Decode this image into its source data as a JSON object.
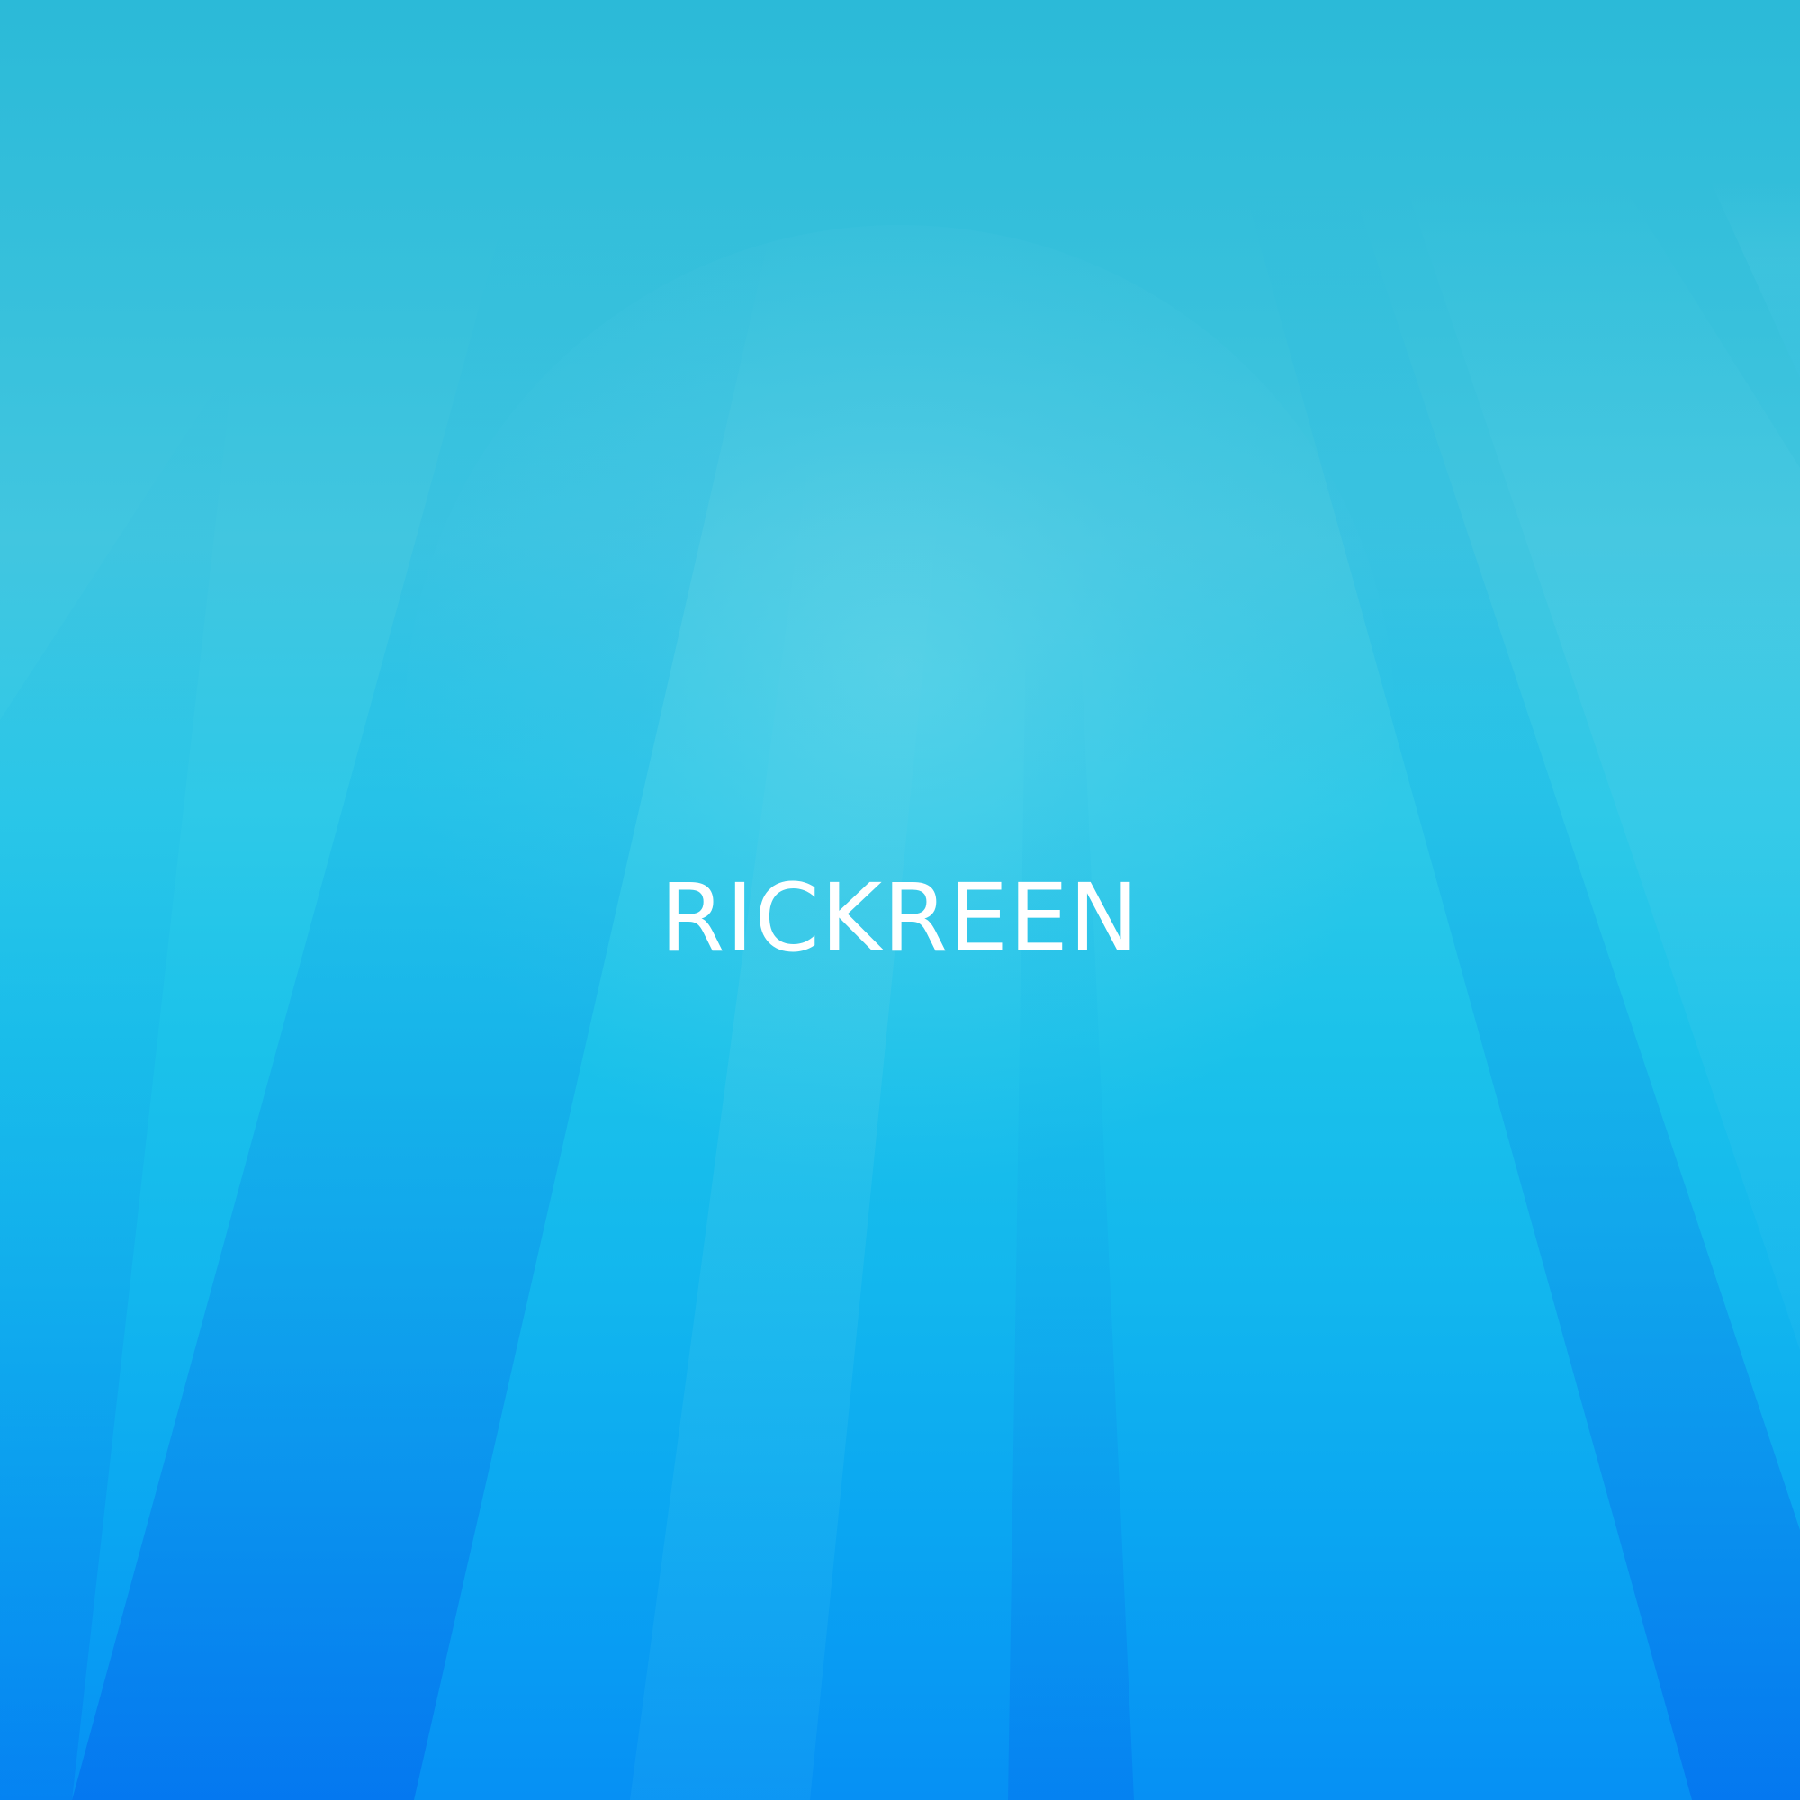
{
  "title": "RICKREEN",
  "colors": {
    "background_top": "#2bbad8",
    "background_middle": "#1bc2ea",
    "background_bottom": "#0690f4",
    "text": "#ffffff"
  }
}
